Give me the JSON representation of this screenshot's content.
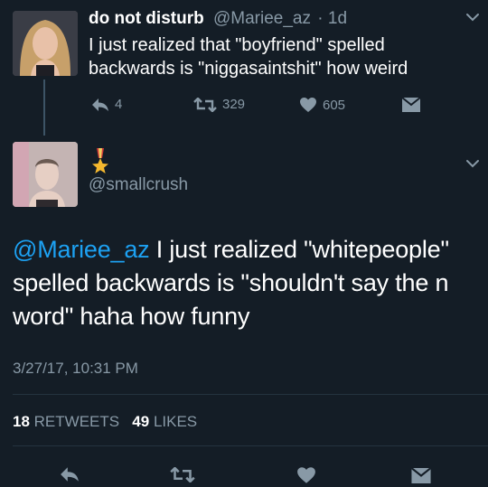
{
  "tweet": {
    "display_name": "do not disturb",
    "handle": "@Mariee_az",
    "age": "· 1d",
    "text": "I just realized that \"boyfriend\" spelled backwards is \"niggasaintshit\" how weird",
    "reply_count": "4",
    "retweet_count": "329",
    "like_count": "605"
  },
  "reply": {
    "handle": "@smallcrush",
    "mention": "@Mariee_az",
    "text": " I just realized \"whitepeople\" spelled backwards is \"shouldn't say the n word\" haha how funny",
    "timestamp": "3/27/17, 10:31 PM",
    "retweets_count": "18",
    "retweets_label": "RETWEETS",
    "likes_count": "49",
    "likes_label": "LIKES"
  },
  "colors": {
    "background": "#141d26",
    "muted": "#8899a6",
    "link": "#1da1f2",
    "divider": "#24333f"
  },
  "icons": [
    "chevron-down-icon",
    "reply-icon",
    "retweet-icon",
    "heart-icon",
    "direct-message-icon",
    "medal-emoji-icon"
  ]
}
